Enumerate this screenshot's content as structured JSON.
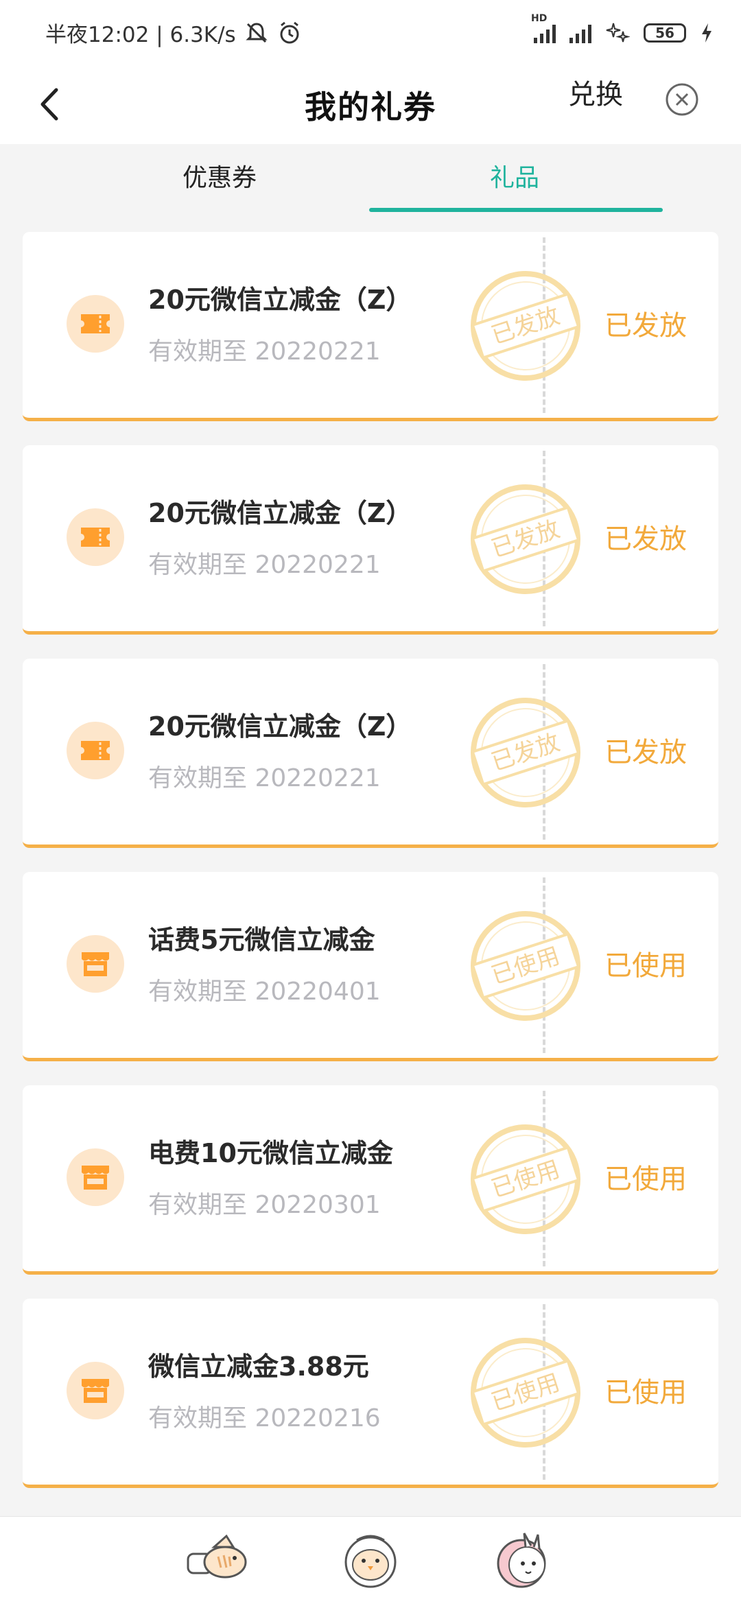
{
  "status_bar": {
    "time_info": "半夜12:02 | 6.3K/s",
    "network_label": "HD",
    "battery": "56"
  },
  "header": {
    "title": "我的礼券",
    "exchange_label": "兑换"
  },
  "tabs": [
    {
      "label": "优惠券",
      "active": false
    },
    {
      "label": "礼品",
      "active": true
    }
  ],
  "gifts": [
    {
      "title": "20元微信立减金（Z）",
      "expiry": "有效期至 20220221",
      "status": "已发放",
      "stamp": "已发放",
      "icon": "ticket-icon"
    },
    {
      "title": "20元微信立减金（Z）",
      "expiry": "有效期至 20220221",
      "status": "已发放",
      "stamp": "已发放",
      "icon": "ticket-icon"
    },
    {
      "title": "20元微信立减金（Z）",
      "expiry": "有效期至 20220221",
      "status": "已发放",
      "stamp": "已发放",
      "icon": "ticket-icon"
    },
    {
      "title": "话费5元微信立减金",
      "expiry": "有效期至 20220401",
      "status": "已使用",
      "stamp": "已使用",
      "icon": "shop-icon"
    },
    {
      "title": "电费10元微信立减金",
      "expiry": "有效期至 20220301",
      "status": "已使用",
      "stamp": "已使用",
      "icon": "shop-icon"
    },
    {
      "title": "微信立减金3.88元",
      "expiry": "有效期至 20220216",
      "status": "已使用",
      "stamp": "已使用",
      "icon": "shop-icon"
    }
  ],
  "colors": {
    "accent_teal": "#1fb39d",
    "status_orange": "#f2a93b",
    "icon_orange": "#ff9f2e",
    "icon_bg": "#fde6cb"
  },
  "bottom_nav": [
    {
      "icon": "fish-icon"
    },
    {
      "icon": "bird-icon"
    },
    {
      "icon": "bunny-icon"
    }
  ]
}
